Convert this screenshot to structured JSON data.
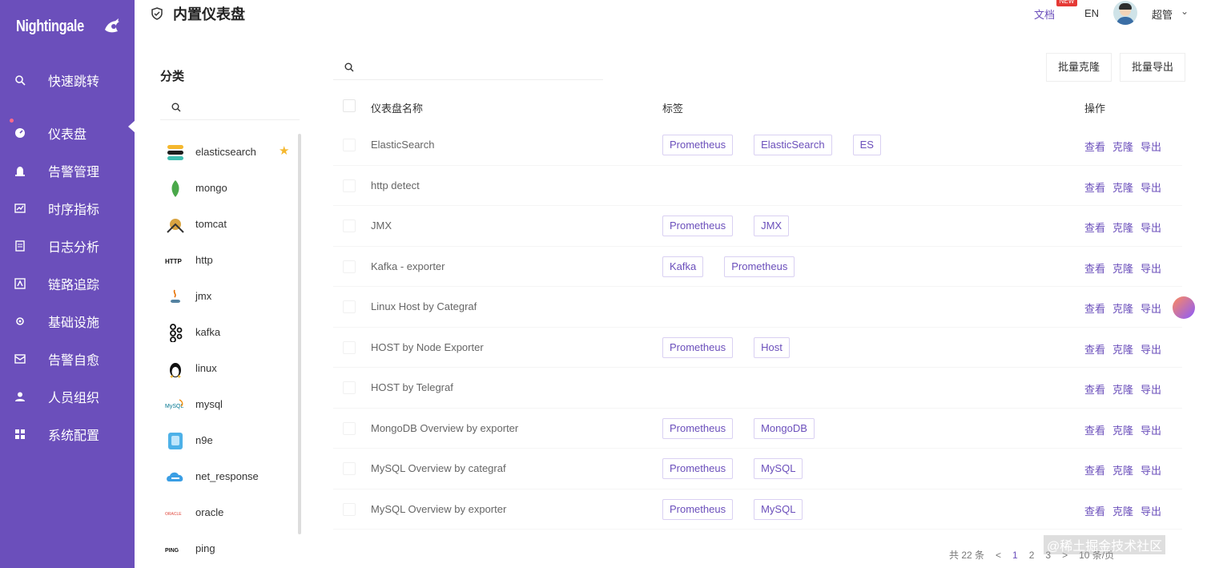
{
  "app": {
    "logo": "Nightingale"
  },
  "sidebar": {
    "items": [
      {
        "label": "快速跳转",
        "icon": "search-icon"
      },
      {
        "label": "仪表盘",
        "icon": "dashboard-icon",
        "active": true
      },
      {
        "label": "告警管理",
        "icon": "alarm-icon"
      },
      {
        "label": "时序指标",
        "icon": "chart-line-icon"
      },
      {
        "label": "日志分析",
        "icon": "log-icon"
      },
      {
        "label": "链路追踪",
        "icon": "trace-icon"
      },
      {
        "label": "基础设施",
        "icon": "infrastructure-icon"
      },
      {
        "label": "告警自愈",
        "icon": "self-heal-icon"
      },
      {
        "label": "人员组织",
        "icon": "user-icon"
      },
      {
        "label": "系统配置",
        "icon": "settings-grid-icon"
      }
    ]
  },
  "header": {
    "title": "内置仪表盘",
    "doc_label": "文档",
    "new_badge": "NEW",
    "lang": "EN",
    "user_name": "超管"
  },
  "categories": {
    "title": "分类",
    "items": [
      {
        "label": "elasticsearch",
        "starred": true
      },
      {
        "label": "mongo"
      },
      {
        "label": "tomcat"
      },
      {
        "label": "http"
      },
      {
        "label": "jmx"
      },
      {
        "label": "kafka"
      },
      {
        "label": "linux"
      },
      {
        "label": "mysql"
      },
      {
        "label": "n9e"
      },
      {
        "label": "net_response"
      },
      {
        "label": "oracle"
      },
      {
        "label": "ping"
      }
    ]
  },
  "toolbar": {
    "clone_label": "批量克隆",
    "export_label": "批量导出"
  },
  "table": {
    "headers": {
      "name": "仪表盘名称",
      "tags": "标签",
      "ops": "操作"
    },
    "rows": [
      {
        "name": "ElasticSearch",
        "tags": [
          "Prometheus",
          "ElasticSearch",
          "ES"
        ]
      },
      {
        "name": "http detect",
        "tags": []
      },
      {
        "name": "JMX",
        "tags": [
          "Prometheus",
          "JMX"
        ]
      },
      {
        "name": "Kafka - exporter",
        "tags": [
          "Kafka",
          "Prometheus"
        ]
      },
      {
        "name": "Linux Host by Categraf",
        "tags": []
      },
      {
        "name": "HOST by Node Exporter",
        "tags": [
          "Prometheus",
          "Host"
        ]
      },
      {
        "name": "HOST by Telegraf",
        "tags": []
      },
      {
        "name": "MongoDB Overview by exporter",
        "tags": [
          "Prometheus",
          "MongoDB"
        ]
      },
      {
        "name": "MySQL Overview by categraf",
        "tags": [
          "Prometheus",
          "MySQL"
        ]
      },
      {
        "name": "MySQL Overview by exporter",
        "tags": [
          "Prometheus",
          "MySQL"
        ]
      }
    ],
    "ops": [
      "查看",
      "克隆",
      "导出"
    ]
  },
  "pager": {
    "total": "共 22 条",
    "pages": [
      "1",
      "2",
      "3"
    ],
    "size": "10 条/页"
  },
  "watermark": "@稀土掘金技术社区",
  "colors": {
    "accent": "#6b4fbb",
    "star": "#f5b82e"
  }
}
